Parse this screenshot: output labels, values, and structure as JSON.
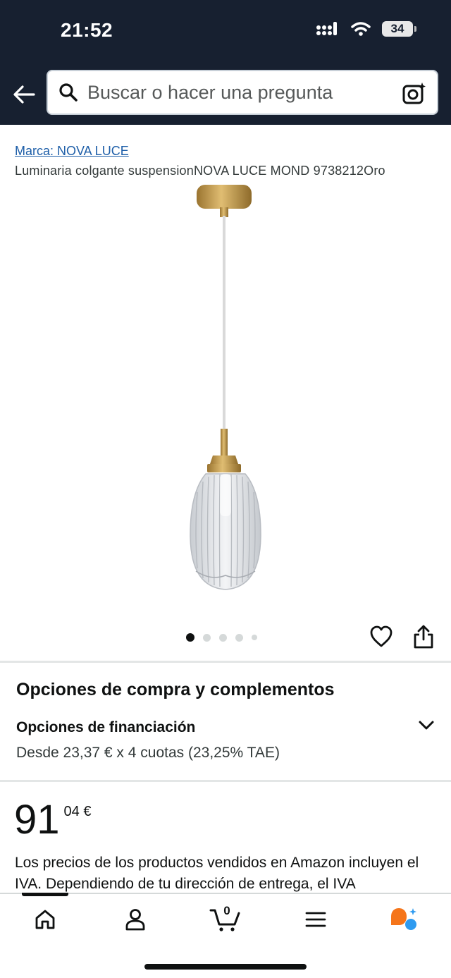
{
  "status_bar": {
    "time": "21:52",
    "battery": "34"
  },
  "search": {
    "placeholder": "Buscar o hacer una pregunta"
  },
  "product": {
    "brand_link": "Marca: NOVA LUCE",
    "title": "Luminaria colgante suspensionNOVA LUCE MOND 9738212Oro",
    "image_count": 5,
    "active_image": 1
  },
  "purchase_options": {
    "heading": "Opciones de compra y complementos",
    "financing_title": "Opciones de financiación",
    "financing_desc": "Desde 23,37 € x 4 cuotas (23,25% TAE)"
  },
  "price": {
    "whole": "91",
    "fraction": "04 €"
  },
  "vat_text": "Los precios de los productos vendidos en Amazon incluyen el IVA. Dependiendo de tu dirección de entrega, el IVA",
  "bottom_nav": {
    "cart_count": "0"
  },
  "icons": [
    "back-arrow-icon",
    "search-icon",
    "camera-search-icon",
    "heart-icon",
    "share-icon",
    "chevron-down-icon",
    "home-icon",
    "account-icon",
    "cart-icon",
    "menu-icon",
    "rufus-assistant-icon"
  ],
  "colors": {
    "header_bg": "#172030",
    "link": "#1d5ea8",
    "assistant_orange": "#f5751a",
    "assistant_blue": "#2f9bf0"
  }
}
